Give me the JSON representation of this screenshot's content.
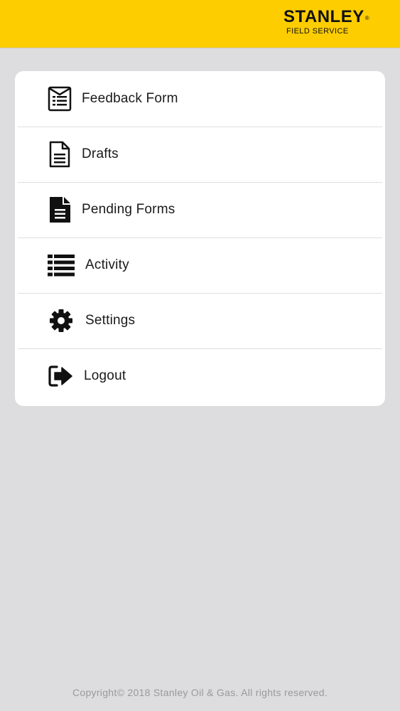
{
  "header": {
    "brand_name": "STANLEY",
    "brand_sub": "FIELD SERVICE",
    "background_color": "#fdcd00"
  },
  "menu": {
    "items": [
      {
        "label": "Feedback Form",
        "icon": "feedback-form-icon"
      },
      {
        "label": "Drafts",
        "icon": "drafts-document-icon"
      },
      {
        "label": "Pending Forms",
        "icon": "pending-document-icon"
      },
      {
        "label": "Activity",
        "icon": "list-icon"
      },
      {
        "label": "Settings",
        "icon": "gear-icon"
      },
      {
        "label": "Logout",
        "icon": "logout-icon"
      }
    ]
  },
  "footer": {
    "copyright": "Copyright© 2018 Stanley Oil & Gas. All rights reserved."
  }
}
